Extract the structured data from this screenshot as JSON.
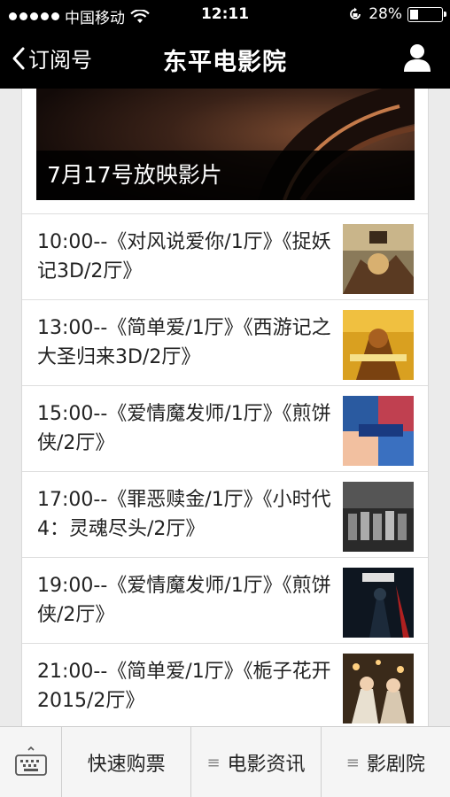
{
  "status_bar": {
    "carrier": "中国移动",
    "time": "12:11",
    "battery_percent": "28%",
    "battery_level": 0.28,
    "signal_bars_filled": 5
  },
  "nav": {
    "back_label": "订阅号",
    "title": "东平电影院",
    "profile_icon": "person-icon"
  },
  "banner": {
    "caption": "7月17号放映影片"
  },
  "schedule": [
    {
      "text": "10:00--《对风说爱你/1厅》《捉妖记3D/2厅》",
      "poster": "poster-monster-hunt"
    },
    {
      "text": "13:00--《简单爱/1厅》《西游记之大圣归来3D/2厅》",
      "poster": "poster-monkey-king"
    },
    {
      "text": "15:00--《爱情魔发师/1厅》《煎饼侠/2厅》",
      "poster": "poster-hair-romance"
    },
    {
      "text": "17:00--《罪恶赎金/1厅》《小时代4：灵魂尽头/2厅》",
      "poster": "poster-tiny-times"
    },
    {
      "text": "19:00--《爱情魔发师/1厅》《煎饼侠/2厅》",
      "poster": "poster-jianbing-man"
    },
    {
      "text": "21:00--《简单爱/1厅》《栀子花开2015/2厅》",
      "poster": "poster-forever-young"
    }
  ],
  "bottom_menu": {
    "keyboard_icon": "keyboard-icon",
    "items": [
      {
        "label": "快速购票",
        "has_menu_icon": false
      },
      {
        "label": "电影资讯",
        "has_menu_icon": true
      },
      {
        "label": "影剧院",
        "has_menu_icon": true
      }
    ]
  },
  "colors": {
    "bar_bg": "#000000",
    "page_bg": "#ebebeb",
    "card_bg": "#ffffff",
    "text": "#222222"
  }
}
